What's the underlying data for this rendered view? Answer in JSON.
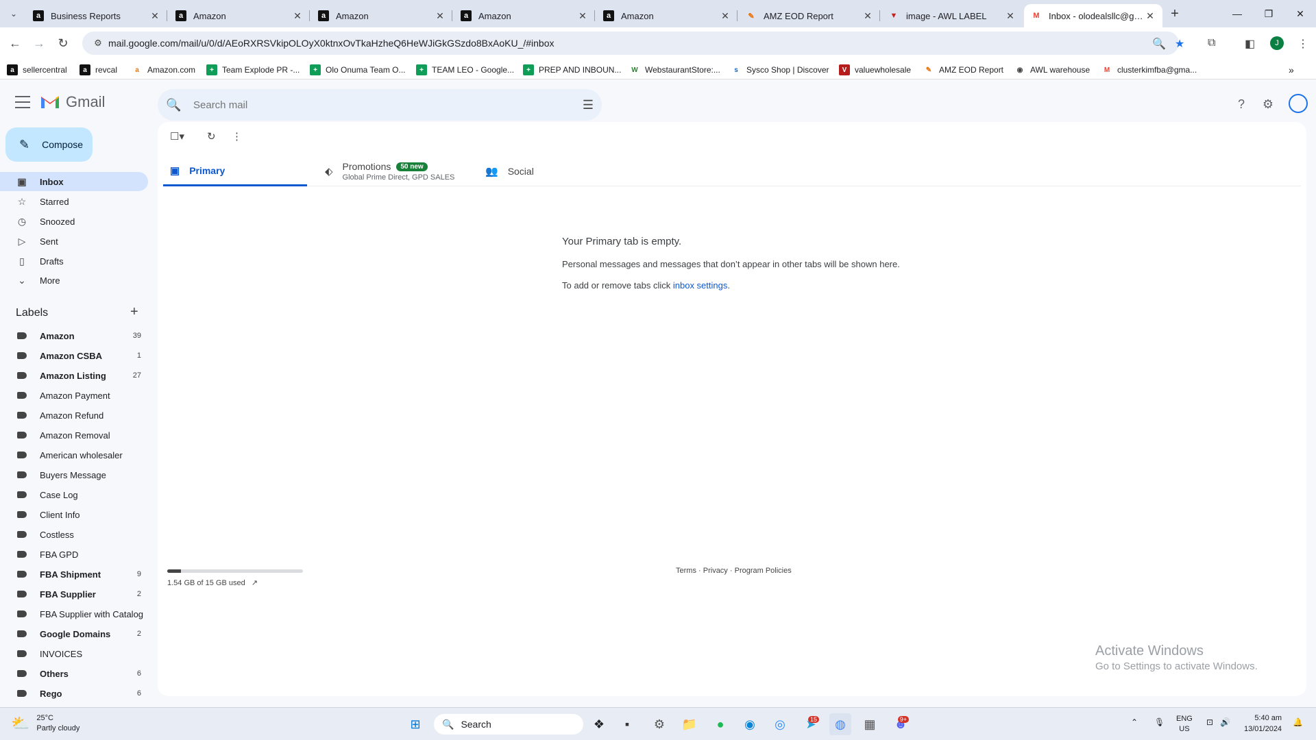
{
  "browser": {
    "tabs": [
      {
        "title": "Business Reports",
        "favicon": "a"
      },
      {
        "title": "Amazon",
        "favicon": "a"
      },
      {
        "title": "Amazon",
        "favicon": "a"
      },
      {
        "title": "Amazon",
        "favicon": "a"
      },
      {
        "title": "Amazon",
        "favicon": "a"
      },
      {
        "title": "AMZ EOD Report",
        "favicon": "✎"
      },
      {
        "title": "image - AWL LABEL",
        "favicon": "▼"
      },
      {
        "title": "Inbox - olodealsllc@gmail.com",
        "favicon": "M"
      }
    ],
    "url": "mail.google.com/mail/u/0/d/AEoRXRSVkipOLOyX0ktnxOvTkaHzheQ6HeWJiGkGSzdo8BxAoKU_/#inbox",
    "profile_initial": "J",
    "bookmarks": [
      {
        "label": "sellercentral",
        "icon": "a"
      },
      {
        "label": "revcal",
        "icon": "a"
      },
      {
        "label": "Amazon.com",
        "icon": "a"
      },
      {
        "label": "Team Explode PR -...",
        "icon": "+"
      },
      {
        "label": "Olo Onuma Team O...",
        "icon": "+"
      },
      {
        "label": "TEAM LEO - Google...",
        "icon": "+"
      },
      {
        "label": "PREP AND INBOUN...",
        "icon": "+"
      },
      {
        "label": "WebstaurantStore:...",
        "icon": "W"
      },
      {
        "label": "Sysco Shop | Discover",
        "icon": "s"
      },
      {
        "label": "valuewholesale",
        "icon": "V"
      },
      {
        "label": "AMZ EOD Report",
        "icon": "✎"
      },
      {
        "label": "AWL warehouse",
        "icon": "◉"
      },
      {
        "label": "clusterkimfba@gma...",
        "icon": "M"
      }
    ]
  },
  "gmail": {
    "app_name": "Gmail",
    "search_placeholder": "Search mail",
    "compose_label": "Compose",
    "nav": [
      {
        "label": "Inbox",
        "icon": "inbox-icon"
      },
      {
        "label": "Starred",
        "icon": "star-icon"
      },
      {
        "label": "Snoozed",
        "icon": "clock-icon"
      },
      {
        "label": "Sent",
        "icon": "send-icon"
      },
      {
        "label": "Drafts",
        "icon": "draft-icon"
      },
      {
        "label": "More",
        "icon": "chevron-down-icon"
      }
    ],
    "labels_heading": "Labels",
    "labels": [
      {
        "name": "Amazon",
        "count": "39",
        "bold": true
      },
      {
        "name": "Amazon CSBA",
        "count": "1",
        "bold": true
      },
      {
        "name": "Amazon Listing",
        "count": "27",
        "bold": true
      },
      {
        "name": "Amazon Payment",
        "count": "",
        "bold": false
      },
      {
        "name": "Amazon Refund",
        "count": "",
        "bold": false
      },
      {
        "name": "Amazon Removal",
        "count": "",
        "bold": false
      },
      {
        "name": "American wholesaler",
        "count": "",
        "bold": false
      },
      {
        "name": "Buyers Message",
        "count": "",
        "bold": false
      },
      {
        "name": "Case Log",
        "count": "",
        "bold": false
      },
      {
        "name": "Client Info",
        "count": "",
        "bold": false
      },
      {
        "name": "Costless",
        "count": "",
        "bold": false
      },
      {
        "name": "FBA GPD",
        "count": "",
        "bold": false
      },
      {
        "name": "FBA Shipment",
        "count": "9",
        "bold": true
      },
      {
        "name": "FBA Supplier",
        "count": "2",
        "bold": true
      },
      {
        "name": "FBA Supplier with Catalog",
        "count": "",
        "bold": false
      },
      {
        "name": "Google Domains",
        "count": "2",
        "bold": true
      },
      {
        "name": "INVOICES",
        "count": "",
        "bold": false
      },
      {
        "name": "Others",
        "count": "6",
        "bold": true
      },
      {
        "name": "Rego",
        "count": "6",
        "bold": true
      }
    ],
    "tabs": {
      "primary": "Primary",
      "promotions": "Promotions",
      "promotions_badge": "50 new",
      "promotions_sub": "Global Prime Direct, GPD SALES",
      "social": "Social"
    },
    "empty": {
      "title": "Your Primary tab is empty.",
      "line1": "Personal messages and messages that don’t appear in other tabs will be shown here.",
      "line2_prefix": "To add or remove tabs click ",
      "line2_link": "inbox settings",
      "line2_suffix": "."
    },
    "storage": {
      "text": "1.54 GB of 15 GB used",
      "used_fraction": 0.103
    },
    "footer": {
      "terms": "Terms",
      "privacy": "Privacy",
      "policies": "Program Policies",
      "sep": "·"
    }
  },
  "watermark": {
    "line1": "Activate Windows",
    "line2": "Go to Settings to activate Windows."
  },
  "taskbar": {
    "weather_temp": "25°C",
    "weather_desc": "Partly cloudy",
    "search_label": "Search",
    "telegram_badge": "15",
    "discord_badge": "9+",
    "lang1": "ENG",
    "lang2": "US",
    "time": "5:40 am",
    "date": "13/01/2024"
  }
}
